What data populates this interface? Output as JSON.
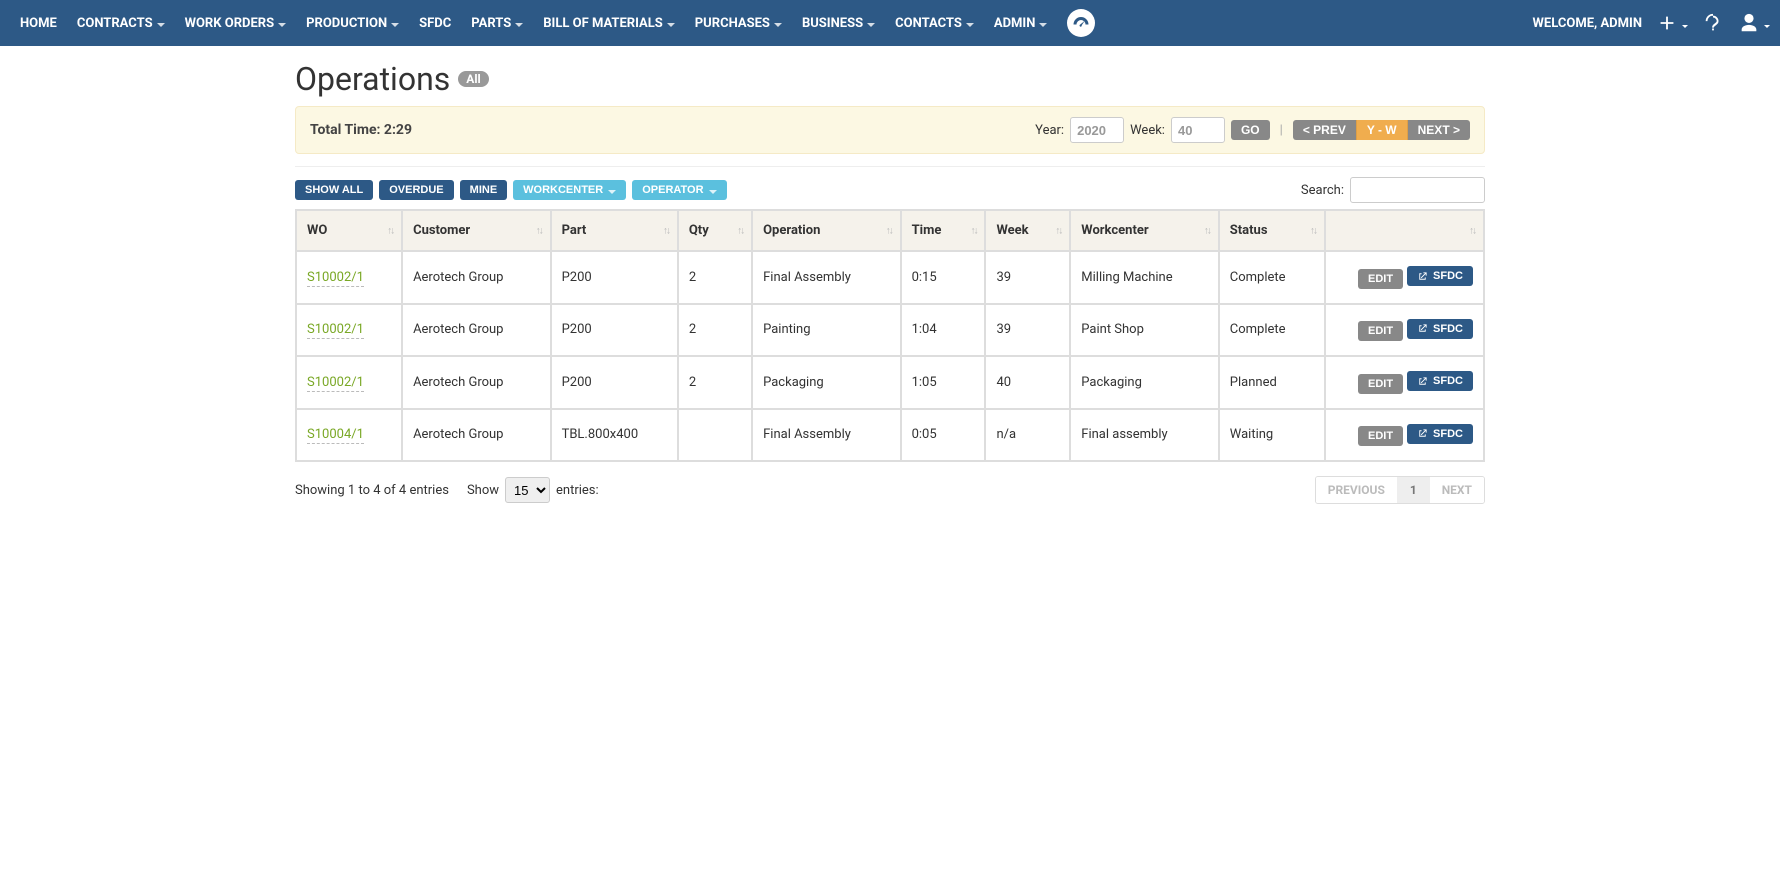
{
  "nav": {
    "items": [
      {
        "label": "HOME",
        "dropdown": false
      },
      {
        "label": "CONTRACTS",
        "dropdown": true
      },
      {
        "label": "WORK ORDERS",
        "dropdown": true
      },
      {
        "label": "PRODUCTION",
        "dropdown": true
      },
      {
        "label": "SFDC",
        "dropdown": false
      },
      {
        "label": "PARTS",
        "dropdown": true
      },
      {
        "label": "BILL OF MATERIALS",
        "dropdown": true
      },
      {
        "label": "PURCHASES",
        "dropdown": true
      },
      {
        "label": "BUSINESS",
        "dropdown": true
      },
      {
        "label": "CONTACTS",
        "dropdown": true
      },
      {
        "label": "ADMIN",
        "dropdown": true
      }
    ],
    "welcome": "WELCOME, ADMIN"
  },
  "page": {
    "title": "Operations",
    "badge": "All"
  },
  "info": {
    "total_time_label": "Total Time: 2:29",
    "year_label": "Year:",
    "year_value": "2020",
    "week_label": "Week:",
    "week_value": "40",
    "go": "GO",
    "prev": "< PREV",
    "yw": "Y - W",
    "next": "NEXT >"
  },
  "filters": {
    "show_all": "SHOW ALL",
    "overdue": "OVERDUE",
    "mine": "MINE",
    "workcenter": "WORKCENTER",
    "operator": "OPERATOR"
  },
  "search": {
    "label": "Search:",
    "value": ""
  },
  "table": {
    "headers": {
      "wo": "WO",
      "customer": "Customer",
      "part": "Part",
      "qty": "Qty",
      "operation": "Operation",
      "time": "Time",
      "week": "Week",
      "workcenter": "Workcenter",
      "status": "Status"
    },
    "rows": [
      {
        "wo": "S10002/1",
        "customer": "Aerotech Group",
        "part": "P200",
        "qty": "2",
        "operation": "Final Assembly",
        "time": "0:15",
        "week": "39",
        "workcenter": "Milling Machine",
        "status": "Complete"
      },
      {
        "wo": "S10002/1",
        "customer": "Aerotech Group",
        "part": "P200",
        "qty": "2",
        "operation": "Painting",
        "time": "1:04",
        "week": "39",
        "workcenter": "Paint Shop",
        "status": "Complete"
      },
      {
        "wo": "S10002/1",
        "customer": "Aerotech Group",
        "part": "P200",
        "qty": "2",
        "operation": "Packaging",
        "time": "1:05",
        "week": "40",
        "workcenter": "Packaging",
        "status": "Planned"
      },
      {
        "wo": "S10004/1",
        "customer": "Aerotech Group",
        "part": "TBL.800x400",
        "qty": "",
        "operation": "Final Assembly",
        "time": "0:05",
        "week": "n/a",
        "workcenter": "Final assembly",
        "status": "Waiting"
      }
    ],
    "actions": {
      "edit": "EDIT",
      "sfdc": "SFDC"
    }
  },
  "footer": {
    "showing": "Showing 1 to 4 of 4 entries",
    "show_label": "Show",
    "entries_label": "entries:",
    "page_len": "15",
    "prev": "PREVIOUS",
    "page": "1",
    "next": "NEXT"
  }
}
